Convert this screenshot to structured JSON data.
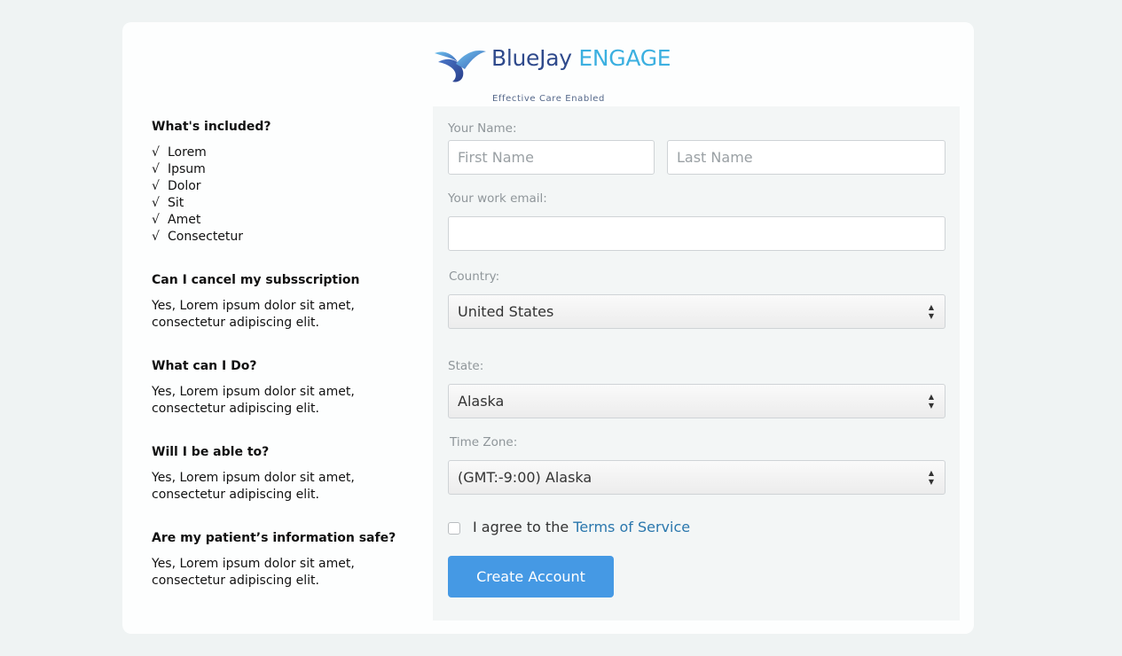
{
  "logo": {
    "name_part1": "BlueJay",
    "name_part2": "ENGAGE",
    "tagline": "Effective Care Enabled",
    "brand_color": "#2f4a8c",
    "accent_color": "#3cb0e0"
  },
  "faq": {
    "included_title": "What's included?",
    "check_symbol": "√",
    "included_items": [
      "Lorem",
      "Ipsum",
      "Dolor",
      "Sit",
      "Amet",
      "Consectetur"
    ],
    "questions": [
      {
        "q": "Can I cancel my subsscription",
        "a1": "Yes, Lorem ipsum dolor sit amet,",
        "a2": "consectetur adipiscing elit."
      },
      {
        "q": "What can I Do?",
        "a1": "Yes, Lorem ipsum dolor sit amet,",
        "a2": "consectetur adipiscing elit."
      },
      {
        "q": "Will I be able to?",
        "a1": "Yes, Lorem ipsum dolor sit amet,",
        "a2": "consectetur adipiscing elit."
      },
      {
        "q": "Are my patient’s information safe?",
        "a1": "Yes, Lorem ipsum dolor sit amet,",
        "a2": "consectetur adipiscing elit."
      }
    ]
  },
  "form": {
    "name_label": "Your Name:",
    "first_name_placeholder": "First Name",
    "last_name_placeholder": "Last Name",
    "email_label": "Your work email:",
    "email_value": "",
    "country_label": "Country:",
    "country_value": "United States",
    "state_label": "State:",
    "state_value": "Alaska",
    "timezone_label": "Time Zone:",
    "timezone_value": "(GMT:-9:00) Alaska",
    "agree_text": "I agree to the ",
    "terms_link": "Terms of Service",
    "agree_checked": false,
    "submit_label": "Create Account",
    "submit_color": "#4599e4",
    "link_color": "#2a77ad"
  }
}
